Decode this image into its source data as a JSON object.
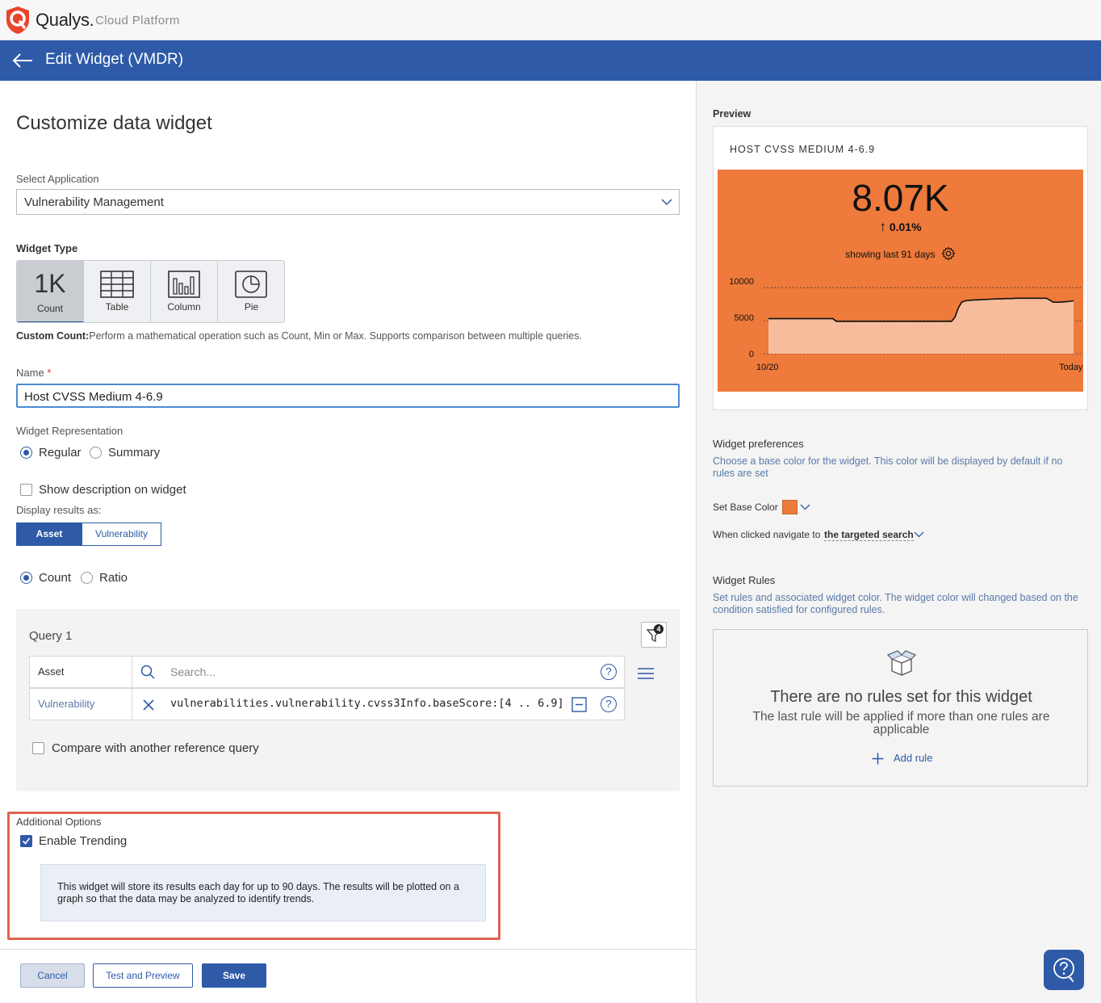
{
  "brand": {
    "name": "Qualys.",
    "sub": "Cloud Platform"
  },
  "header": {
    "title": "Edit Widget (VMDR)"
  },
  "page": {
    "title": "Customize data widget"
  },
  "application": {
    "label": "Select Application",
    "value": "Vulnerability Management"
  },
  "widget_type": {
    "label": "Widget Type",
    "options": [
      {
        "big": "1K",
        "label": "Count",
        "selected": true
      },
      {
        "label": "Table"
      },
      {
        "label": "Column"
      },
      {
        "label": "Pie"
      }
    ],
    "desc_bold": "Custom Count:",
    "desc": "Perform a mathematical operation such as Count, Min or Max. Supports comparison between multiple queries."
  },
  "name_field": {
    "label": "Name",
    "required": "*",
    "value": "Host CVSS Medium 4-6.9"
  },
  "representation": {
    "label": "Widget Representation",
    "regular": "Regular",
    "summary": "Summary",
    "selected": "Regular"
  },
  "show_description": {
    "label": "Show description on widget",
    "checked": false
  },
  "display_results": {
    "label": "Display results as:",
    "asset": "Asset",
    "vulnerability": "Vulnerability",
    "selected": "Asset"
  },
  "count_ratio": {
    "count": "Count",
    "ratio": "Ratio",
    "selected": "Count"
  },
  "query": {
    "title": "Query 1",
    "filter_badge": "4",
    "rows": [
      {
        "label": "Asset",
        "placeholder": "Search..."
      },
      {
        "label": "Vulnerability",
        "value": "vulnerabilities.vulnerability.cvss3Info.baseScore:[4 .. 6.9]"
      }
    ],
    "compare_label": "Compare with another reference query"
  },
  "additional": {
    "label": "Additional Options",
    "trending_label": "Enable Trending",
    "trending_checked": true,
    "info": "This widget will store its results each day for up to 90 days. The results will be plotted on a graph so that the data may be analyzed to identify trends."
  },
  "buttons": {
    "cancel": "Cancel",
    "test": "Test and Preview",
    "save": "Save"
  },
  "preview": {
    "label": "Preview",
    "card_title": "HOST CVSS MEDIUM 4-6.9",
    "value": "8.07K",
    "change": "0.01%",
    "showing": "showing last 91 days",
    "color": "#ee7a3b"
  },
  "chart_data": {
    "type": "area",
    "x_labels": [
      "10/20",
      "Today"
    ],
    "y_ticks": [
      0,
      5000,
      10000
    ],
    "ylim": [
      0,
      11000
    ],
    "grid": true,
    "values": [
      5300,
      5300,
      5300,
      5300,
      5300,
      5300,
      5300,
      5300,
      5300,
      5300,
      5300,
      5300,
      5300,
      5300,
      5300,
      5300,
      5300,
      5300,
      5300,
      5300,
      4900,
      4900,
      4900,
      4900,
      4900,
      4900,
      4900,
      4900,
      4900,
      4900,
      4900,
      4900,
      4900,
      4900,
      4900,
      4900,
      4900,
      4900,
      4900,
      4900,
      4900,
      4900,
      4900,
      4900,
      4900,
      4900,
      4900,
      4900,
      4900,
      4900,
      4900,
      4900,
      4900,
      4900,
      4900,
      5500,
      6900,
      7800,
      8000,
      8050,
      8100,
      8150,
      8150,
      8200,
      8200,
      8250,
      8250,
      8300,
      8300,
      8300,
      8350,
      8350,
      8350,
      8400,
      8400,
      8400,
      8400,
      8400,
      8400,
      8400,
      8400,
      8400,
      8400,
      8100,
      7800,
      7800,
      7800,
      7850,
      7900,
      7950,
      8000
    ]
  },
  "preferences": {
    "title": "Widget preferences",
    "desc": "Choose a base color for the widget. This color will be displayed by default if no rules are set",
    "base_color_label": "Set Base Color",
    "nav_label": "When clicked navigate to",
    "nav_value": "the targeted search"
  },
  "rules": {
    "title": "Widget Rules",
    "desc": "Set rules and associated widget color. The widget color will changed based on the condition satisfied for configured rules.",
    "empty_title": "There are no rules set for this widget",
    "empty_sub": "The last rule will be applied if more than one rules are applicable",
    "add_label": "Add rule"
  }
}
